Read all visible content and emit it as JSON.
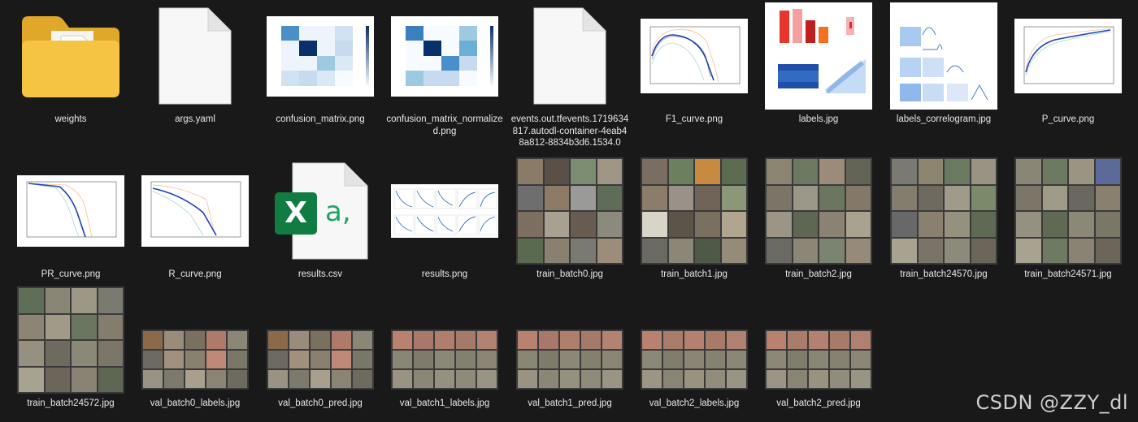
{
  "files": [
    {
      "name": "weights",
      "type": "folder"
    },
    {
      "name": "args.yaml",
      "type": "document"
    },
    {
      "name": "confusion_matrix.png",
      "type": "image"
    },
    {
      "name": "confusion_matrix_normalized.png",
      "type": "image"
    },
    {
      "name": "events.out.tfevents.1719634817.autodl-container-4eab48a812-8834b3d6.1534.0",
      "type": "document"
    },
    {
      "name": "F1_curve.png",
      "type": "image"
    },
    {
      "name": "labels.jpg",
      "type": "image"
    },
    {
      "name": "labels_correlogram.jpg",
      "type": "image"
    },
    {
      "name": "P_curve.png",
      "type": "image"
    },
    {
      "name": "PR_curve.png",
      "type": "image"
    },
    {
      "name": "R_curve.png",
      "type": "image"
    },
    {
      "name": "results.csv",
      "type": "excel"
    },
    {
      "name": "results.png",
      "type": "image"
    },
    {
      "name": "train_batch0.jpg",
      "type": "image"
    },
    {
      "name": "train_batch1.jpg",
      "type": "image"
    },
    {
      "name": "train_batch2.jpg",
      "type": "image"
    },
    {
      "name": "train_batch24570.jpg",
      "type": "image"
    },
    {
      "name": "train_batch24571.jpg",
      "type": "image"
    },
    {
      "name": "train_batch24572.jpg",
      "type": "image"
    },
    {
      "name": "val_batch0_labels.jpg",
      "type": "image"
    },
    {
      "name": "val_batch0_pred.jpg",
      "type": "image"
    },
    {
      "name": "val_batch1_labels.jpg",
      "type": "image"
    },
    {
      "name": "val_batch1_pred.jpg",
      "type": "image"
    },
    {
      "name": "val_batch2_labels.jpg",
      "type": "image"
    },
    {
      "name": "val_batch2_pred.jpg",
      "type": "image"
    }
  ],
  "icons": {
    "excel_letter": "X",
    "excel_suffix": "a,"
  },
  "colors": {
    "background": "#191919",
    "label_text": "#e8e8e8",
    "folder": "#f5c443",
    "excel_green": "#107c41",
    "excel_accent": "#21a366"
  },
  "watermark": "CSDN @ZZY_dl"
}
